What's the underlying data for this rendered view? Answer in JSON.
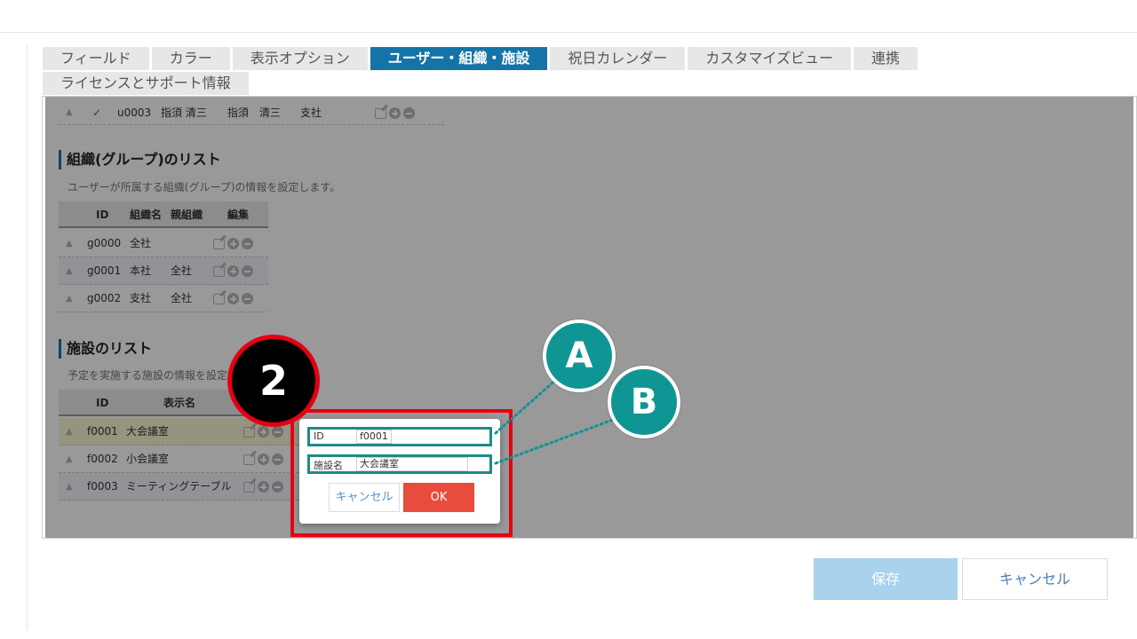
{
  "tabs_row1": [
    "フィールド",
    "カラー",
    "表示オプション",
    "ユーザー・組織・施設",
    "祝日カレンダー",
    "カスタマイズビュー",
    "連携"
  ],
  "tabs_row2": [
    "ライセンスとサポート情報"
  ],
  "active_tab": "ユーザー・組織・施設",
  "user_row": {
    "id": "u0003",
    "name": "指須 清三",
    "display": "指須　清三",
    "org": "支社"
  },
  "groups": {
    "title": "組織(グループ)のリスト",
    "desc": "ユーザーが所属する組織(グループ)の情報を設定します。",
    "headers": [
      "ID",
      "組織名",
      "親組織",
      "編集"
    ],
    "rows": [
      {
        "id": "g0000",
        "name": "全社",
        "parent": ""
      },
      {
        "id": "g0001",
        "name": "本社",
        "parent": "全社"
      },
      {
        "id": "g0002",
        "name": "支社",
        "parent": "全社"
      }
    ]
  },
  "facilities": {
    "title": "施設のリスト",
    "desc": "予定を実施する施設の情報を設定",
    "headers": [
      "ID",
      "表示名"
    ],
    "rows": [
      {
        "id": "f0001",
        "name": "大会議室"
      },
      {
        "id": "f0002",
        "name": "小会議室"
      },
      {
        "id": "f0003",
        "name": "ミーティングテーブル"
      }
    ]
  },
  "dialog": {
    "id_label": "ID",
    "id_value": "f0001",
    "name_label": "施設名",
    "name_value": "大会議室",
    "cancel_label": "キャンセル",
    "ok_label": "OK"
  },
  "annotations": {
    "step": "2",
    "a": "A",
    "b": "B"
  },
  "footer": {
    "save_label": "保存",
    "cancel_label": "キャンセル"
  },
  "colors": {
    "tab_active": "#1474a8",
    "highlight": "#e50012",
    "badge_teal": "#0f9694",
    "ok_button": "#e74c3c",
    "save_button": "#a9d2ec"
  }
}
